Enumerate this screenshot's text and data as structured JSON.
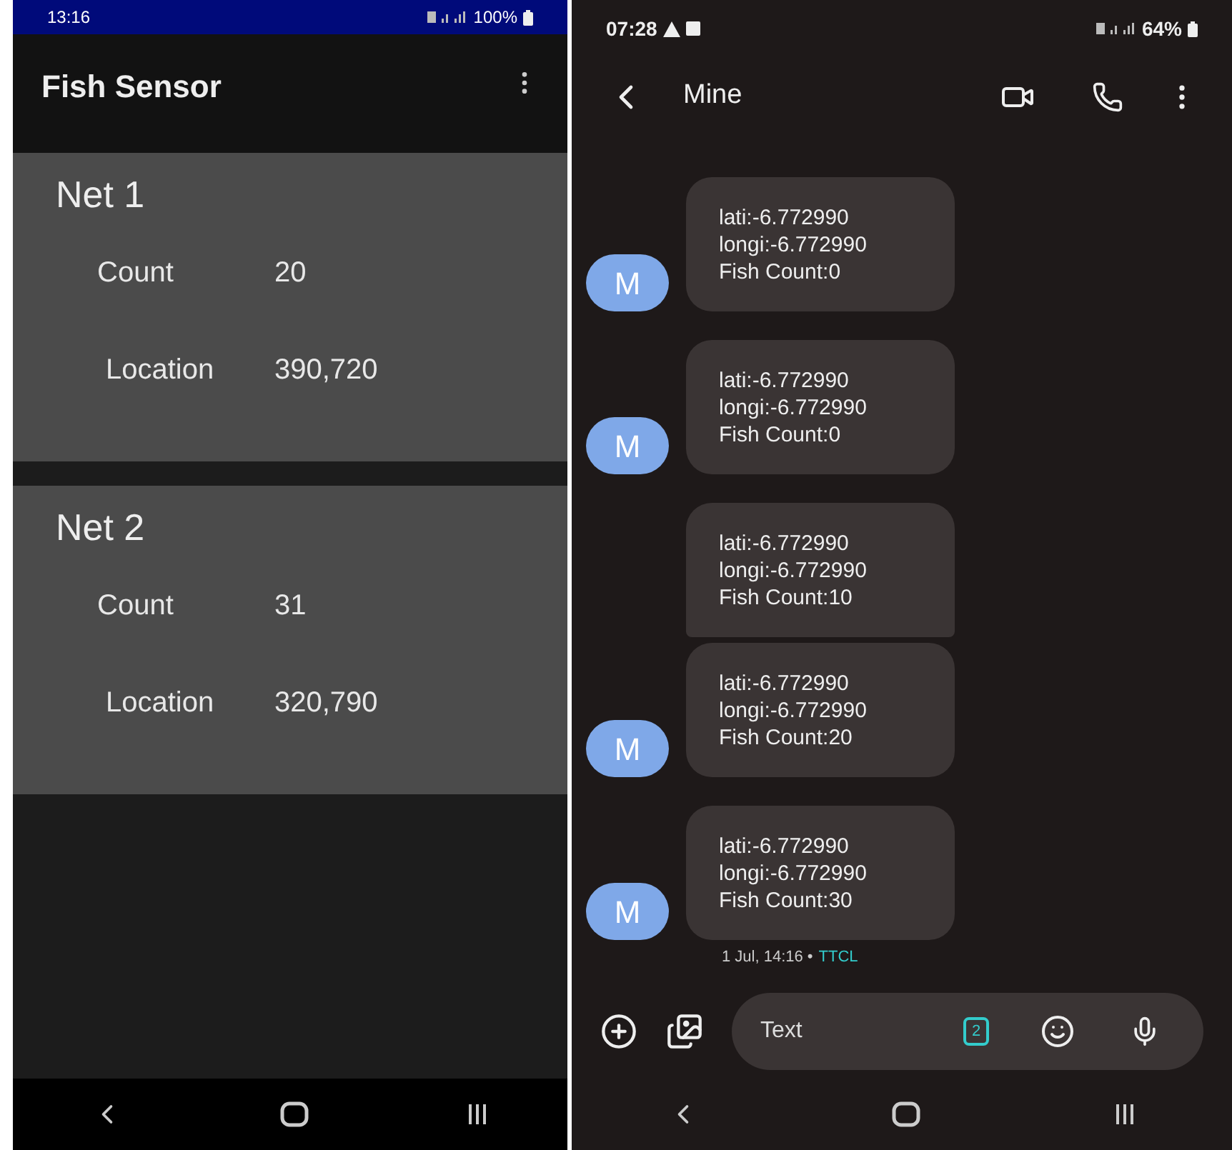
{
  "left_phone": {
    "status_bar": {
      "time": "13:16",
      "battery": "100%"
    },
    "app_bar": {
      "title": "Fish Sensor"
    },
    "nets": [
      {
        "title": "Net 1",
        "fields": [
          {
            "label": "Count",
            "value": "20"
          },
          {
            "label": "Location",
            "value": "390,720"
          }
        ]
      },
      {
        "title": "Net 2",
        "fields": [
          {
            "label": "Count",
            "value": "31"
          },
          {
            "label": "Location",
            "value": "320,790"
          }
        ]
      }
    ]
  },
  "right_phone": {
    "status_bar": {
      "time": "07:28",
      "battery": "64%"
    },
    "header": {
      "contact": "Mine"
    },
    "messages": [
      {
        "lines": [
          "lati:-6.772990",
          "longi:-6.772990",
          "Fish Count:0"
        ],
        "avatar": "M"
      },
      {
        "lines": [
          "lati:-6.772990",
          "longi:-6.772990",
          "Fish Count:0"
        ],
        "avatar": "M"
      },
      {
        "lines": [
          "lati:-6.772990",
          "longi:-6.772990",
          "Fish Count:10"
        ]
      },
      {
        "lines": [
          "lati:-6.772990",
          "longi:-6.772990",
          "Fish Count:20"
        ],
        "avatar": "M"
      },
      {
        "lines": [
          "lati:-6.772990",
          "longi:-6.772990",
          "Fish Count:30"
        ],
        "avatar": "M"
      }
    ],
    "timestamp": {
      "time": "1 Jul, 14:16 •",
      "carrier": "TTCL"
    },
    "composer": {
      "placeholder": "Text",
      "sim": "2"
    }
  }
}
